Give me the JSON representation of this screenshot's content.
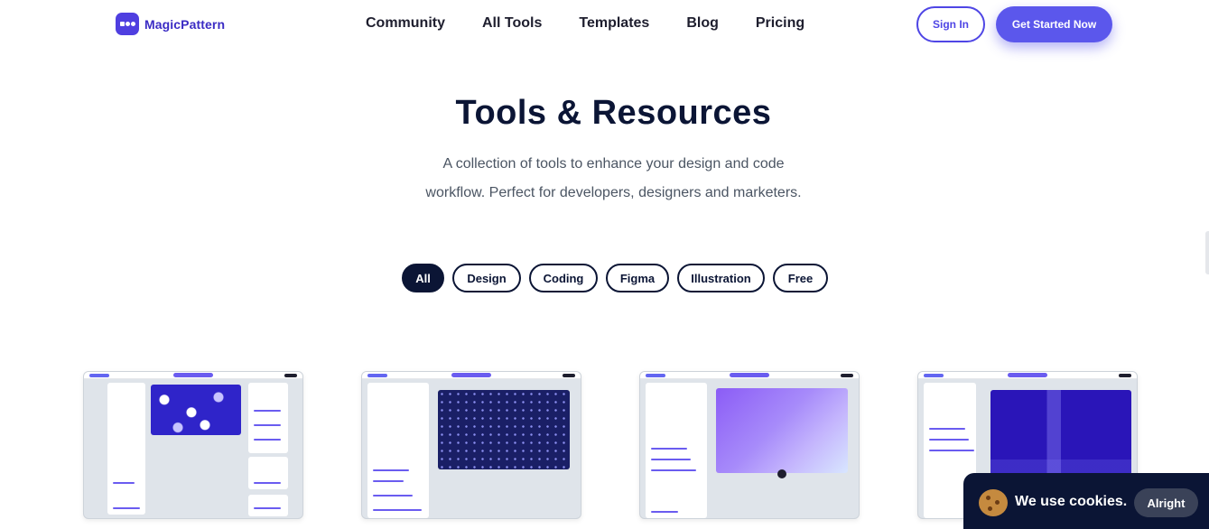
{
  "header": {
    "logo_text": "MagicPattern",
    "nav": [
      "Community",
      "All Tools",
      "Templates",
      "Blog",
      "Pricing"
    ],
    "sign_in": "Sign In",
    "get_started": "Get Started Now"
  },
  "hero": {
    "title": "Tools & Resources",
    "subtitle_line1": "A collection of tools to enhance your design and code",
    "subtitle_line2": "workflow. Perfect for developers, designers and marketers."
  },
  "filters": [
    "All",
    "Design",
    "Coding",
    "Figma",
    "Illustration",
    "Free"
  ],
  "active_filter": "All",
  "cookie": {
    "text": "We use cookies.",
    "button": "Alright"
  },
  "colors": {
    "brand": "#4f46e5",
    "dark": "#0b1535"
  }
}
